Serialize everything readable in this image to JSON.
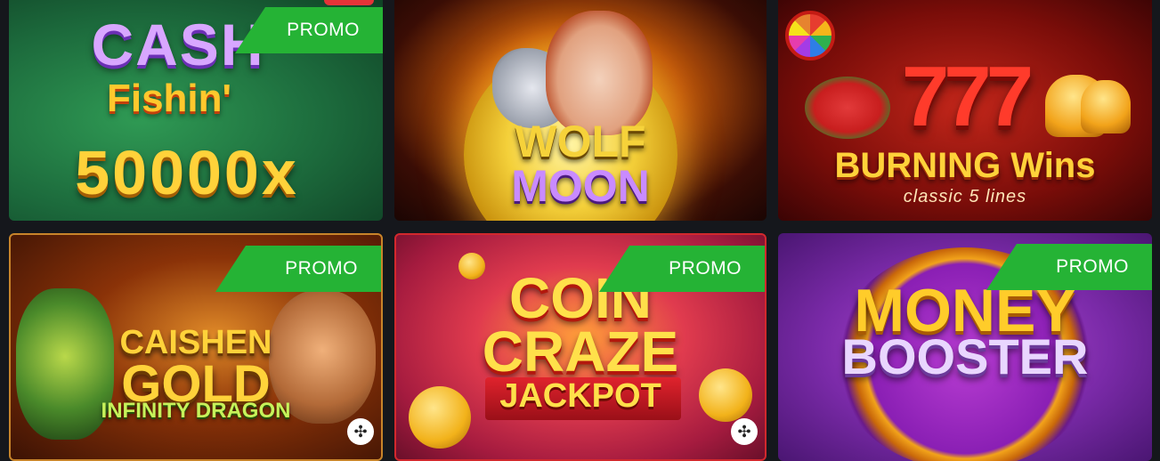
{
  "games": [
    {
      "title_lines": [
        "CASH",
        "Fishin'",
        "50000x"
      ],
      "badge": "PROMO"
    },
    {
      "title_lines": [
        "WOLF",
        "MOON"
      ],
      "badge": ""
    },
    {
      "title_lines": [
        "777",
        "BURNING Wins",
        "classic 5 lines"
      ],
      "badge": ""
    },
    {
      "title_lines": [
        "CAISHEN",
        "GOLD",
        "INFINITY DRAGON"
      ],
      "badge": "PROMO",
      "provider_icon": "roulette-wheel-icon"
    },
    {
      "title_lines": [
        "COIN",
        "CRAZE",
        "JACKPOT"
      ],
      "badge": "PROMO",
      "provider_icon": "roulette-wheel-icon"
    },
    {
      "title_lines": [
        "MONEY",
        "BOOSTER"
      ],
      "badge": "PROMO"
    }
  ],
  "colors": {
    "promo_badge": "#25b335",
    "background": "#15171c"
  },
  "icons": {
    "provider": "✣"
  }
}
